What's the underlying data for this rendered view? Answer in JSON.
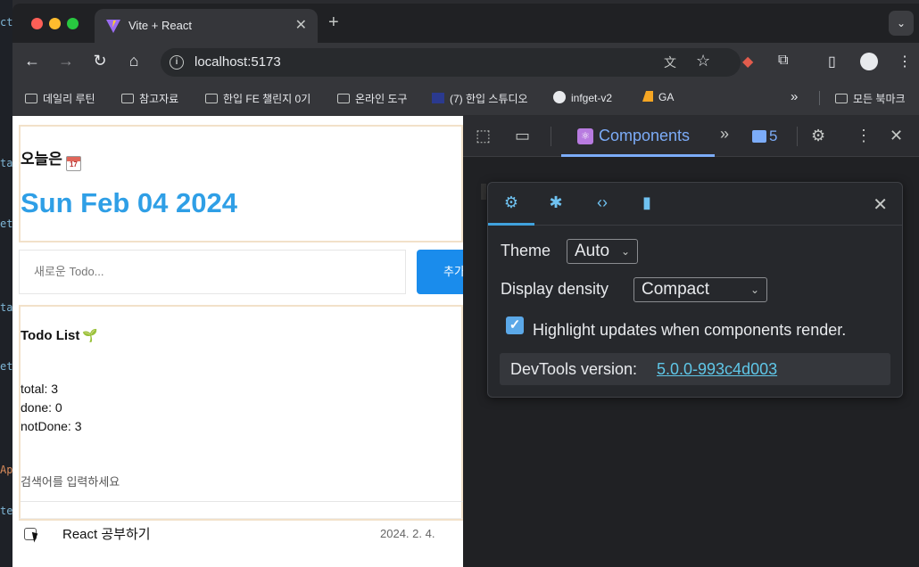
{
  "browser": {
    "tab_title": "Vite + React",
    "url": "localhost:5173"
  },
  "bookmarks": [
    {
      "label": "데일리 루틴",
      "type": "folder"
    },
    {
      "label": "참고자료",
      "type": "folder"
    },
    {
      "label": "한입 FE 챌린지 0기",
      "type": "folder"
    },
    {
      "label": "온라인 도구",
      "type": "folder"
    },
    {
      "label": "(7) 한입 스튜디오",
      "type": "site"
    },
    {
      "label": "infget-v2",
      "type": "github"
    },
    {
      "label": "GA",
      "type": "analytics"
    },
    {
      "label": "모든 북마크",
      "type": "folder"
    }
  ],
  "app": {
    "today_label": "오늘은",
    "today_date": "Sun Feb 04 2024",
    "input_placeholder": "새로운 Todo...",
    "add_button": "추가",
    "list_title": "Todo List",
    "stats": {
      "total": "total: 3",
      "done": "done: 0",
      "not_done": "notDone: 3"
    },
    "search_placeholder": "검색어를 입력하세요",
    "items": [
      {
        "content": "React 공부하기",
        "date": "2024. 2. 4.",
        "done": false
      }
    ]
  },
  "devtools": {
    "active_tab": "Components",
    "issues_count": "5",
    "settings": {
      "theme_label": "Theme",
      "theme_value": "Auto",
      "density_label": "Display density",
      "density_value": "Compact",
      "highlight_label": "Highlight updates when components render.",
      "highlight_checked": true,
      "version_label": "DevTools version:",
      "version_value": "5.0.0-993c4d003"
    }
  },
  "colors": {
    "date_blue": "#2f9fe6",
    "add_button_blue": "#1a8cec",
    "devtools_accent": "#7cacf8",
    "link_cyan": "#5fc7e8"
  }
}
